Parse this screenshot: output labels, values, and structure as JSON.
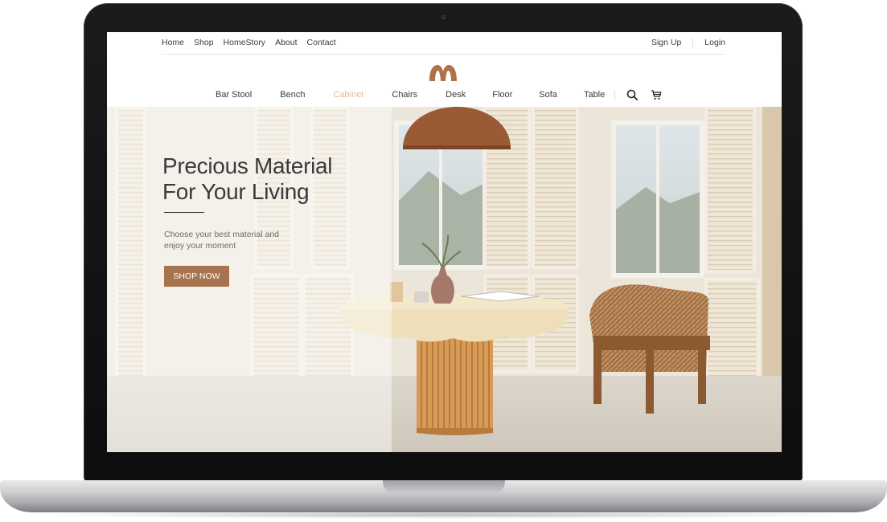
{
  "top_nav": {
    "links": [
      "Home",
      "Shop",
      "HomeStory",
      "About",
      "Contact"
    ],
    "sign_up": "Sign Up",
    "login": "Login"
  },
  "brand": {
    "logo_icon": "m-logo-icon",
    "accent_color": "#b0704a"
  },
  "category_nav": {
    "items": [
      "Bar Stool",
      "Bench",
      "Cabinet",
      "Chairs",
      "Desk",
      "Floor",
      "Sofa",
      "Table"
    ],
    "active_index": 2,
    "active_color": "#e7b98f",
    "icons": [
      "search-icon",
      "cart-icon"
    ]
  },
  "hero": {
    "title_line1": "Precious Material",
    "title_line2": "For Your Living",
    "subtitle_line1": "Choose your best material and",
    "subtitle_line2": "enjoy your moment",
    "cta_label": "SHOP NOW",
    "cta_color": "#a7734f"
  }
}
